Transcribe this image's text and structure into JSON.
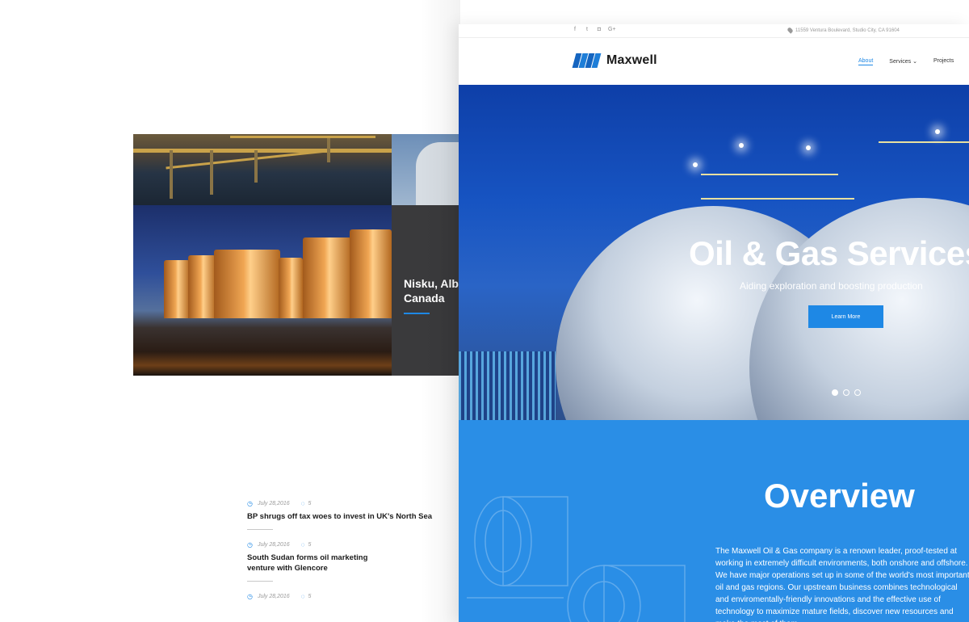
{
  "colors": {
    "accent": "#1e88e5",
    "overview_bg": "#2a8ee6",
    "location_card_bg": "#3a3a3c"
  },
  "back_page": {
    "location": {
      "title": "Nisku, Albe\nCanada"
    },
    "news": [
      {
        "date": "July 28,2016",
        "comments": "5",
        "title": "BP shrugs off tax woes to invest in UK's North Sea"
      },
      {
        "date": "July 28,2016",
        "comments": "5",
        "title": "South Sudan forms oil marketing venture with Glencore"
      },
      {
        "date": "July 28,2016",
        "comments": "5",
        "title": ""
      }
    ]
  },
  "front_page": {
    "topbar": {
      "social_icons": [
        "facebook-icon",
        "twitter-icon",
        "instagram-icon",
        "google-plus-icon"
      ],
      "social_glyphs": [
        "f",
        "t",
        "◘",
        "G+"
      ],
      "address": "11559 Ventura Boulevard, Studio City, CA 91604"
    },
    "header": {
      "logo_text": "Maxwell",
      "nav": [
        "About",
        "Services",
        "Projects"
      ]
    },
    "hero": {
      "title": "Oil & Gas Services",
      "subtitle": "Aiding exploration and boosting production",
      "button": "Learn More",
      "slides": 3,
      "active_slide": 1
    },
    "overview": {
      "title": "Overview",
      "text": "The Maxwell Oil & Gas company is a renown leader, proof-tested at working in extremely difficult environments, both onshore and offshore. We have major operations set up in some of the world's most important oil and gas regions. Our upstream business combines technological and enviromentally-friendly innovations and the effective use of technology to maximize mature fields, discover new resources and make the most of them."
    }
  }
}
